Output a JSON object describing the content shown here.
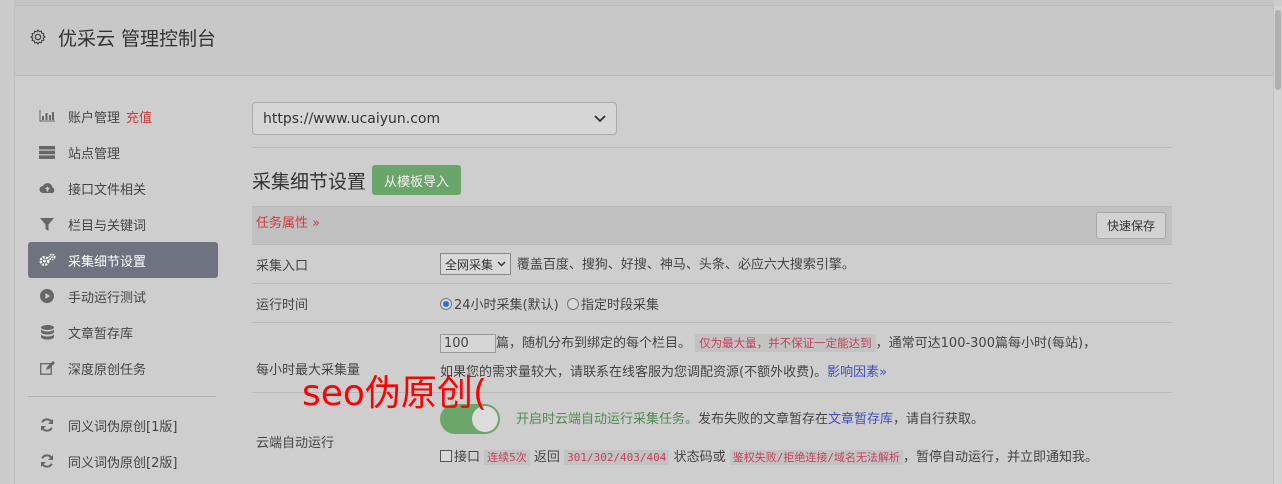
{
  "header": {
    "title": "优采云 管理控制台"
  },
  "sidebar": {
    "items": [
      {
        "label": "账户管理",
        "badge": "充值",
        "icon": "bar-chart-icon"
      },
      {
        "label": "站点管理",
        "icon": "server-icon"
      },
      {
        "label": "接口文件相关",
        "icon": "cloud-upload-icon"
      },
      {
        "label": "栏目与关键词",
        "icon": "filter-icon"
      },
      {
        "label": "采集细节设置",
        "icon": "gears-icon",
        "active": true
      },
      {
        "label": "手动运行测试",
        "icon": "play-circle-icon"
      },
      {
        "label": "文章暂存库",
        "icon": "database-icon"
      },
      {
        "label": "深度原创任务",
        "icon": "edit-icon"
      }
    ],
    "items2": [
      {
        "label": "同义词伪原创[1版]",
        "icon": "refresh-icon"
      },
      {
        "label": "同义词伪原创[2版]",
        "icon": "refresh-icon"
      }
    ]
  },
  "main": {
    "site_select": "https://www.ucaiyun.com",
    "section_title": "采集细节设置",
    "import_button": "从模板导入",
    "attr_label": "任务属性",
    "quick_save": "快速保存",
    "rows": {
      "entry": {
        "label": "采集入口",
        "select": "全网采集",
        "desc": "覆盖百度、搜狗、好搜、神马、头条、必应六大搜索引擎。"
      },
      "time": {
        "label": "运行时间",
        "opt1": "24小时采集(默认)",
        "opt2": "指定时段采集"
      },
      "max": {
        "label": "每小时最大采集量",
        "value": "100",
        "text1": "篇，随机分布到绑定的每个栏目。",
        "warn": "仅为最大量，并不保证一定能达到",
        "text2": "，通常可达100-300篇每小时(每站)，",
        "text3": "如果您的需求量较大，请联系在线客服为您调配资源(不额外收费)。",
        "link": "影响因素"
      },
      "cloud": {
        "label": "云端自动运行",
        "green_text": "开启时云端自动运行采集任务。",
        "text1": "发布失败的文章暂存在",
        "link": "文章暂存库",
        "text2": "，请自行获取。",
        "check_label": "接口",
        "code1": "连续5次",
        "text3": "返回",
        "code2": "301/302/403/404",
        "text4": "状态码或",
        "code3": "鉴权失败/拒绝连接/域名无法解析",
        "text5": "，暂停自动运行，并立即通知我。"
      }
    }
  },
  "overlay_text": "seo伪原创(",
  "colors": {
    "accent_red": "#d03a3a",
    "toggle_green": "#6ba66b",
    "active_nav": "#6e7380",
    "overlay_red": "#ff0000"
  }
}
